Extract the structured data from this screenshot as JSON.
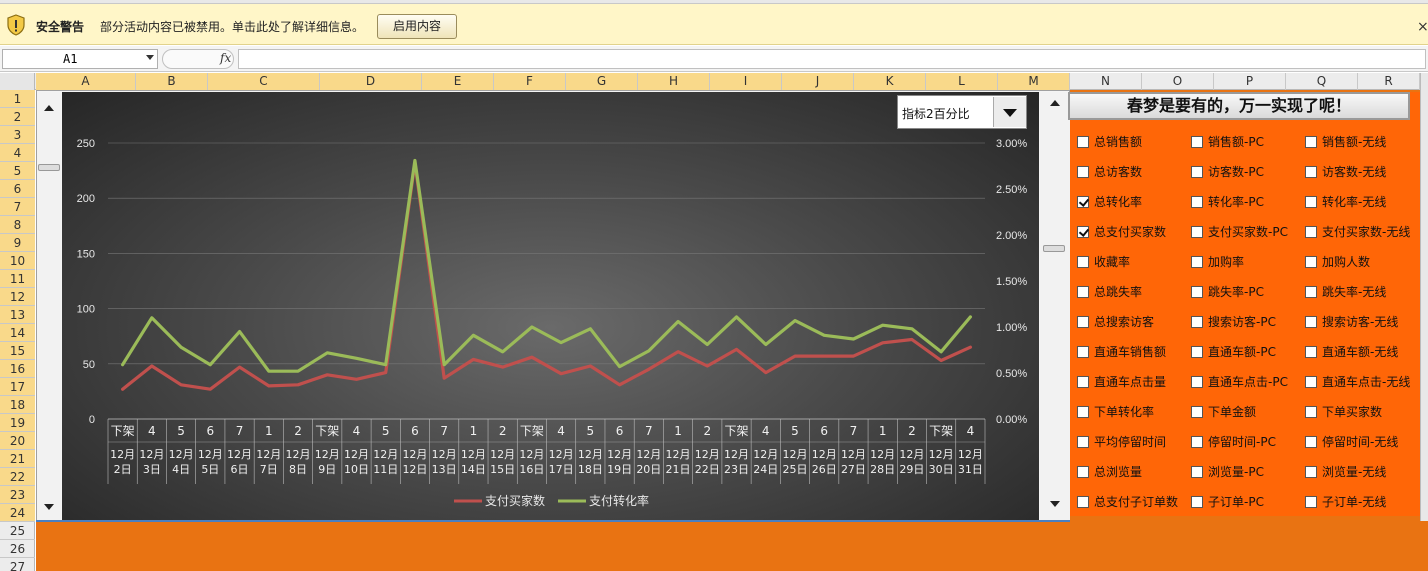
{
  "security_bar": {
    "title": "安全警告",
    "message": "部分活动内容已被禁用。单击此处了解详细信息。",
    "enable_button": "启用内容",
    "close": "×"
  },
  "formula_bar": {
    "name_box": "A1",
    "fx": "fx",
    "formula": ""
  },
  "columns": [
    "A",
    "B",
    "C",
    "D",
    "E",
    "F",
    "G",
    "H",
    "I",
    "J",
    "K",
    "L",
    "M",
    "N",
    "O",
    "P",
    "Q",
    "R"
  ],
  "rows": [
    "1",
    "2",
    "3",
    "4",
    "5",
    "6",
    "7",
    "8",
    "9",
    "10",
    "11",
    "12",
    "13",
    "14",
    "15",
    "16",
    "17",
    "18",
    "19",
    "20",
    "21",
    "22",
    "23",
    "24",
    "25",
    "26",
    "27"
  ],
  "dropdown": {
    "selected": "指标2百分比"
  },
  "panel": {
    "title": "春梦是要有的，万一实现了呢！",
    "checkboxes": [
      [
        {
          "label": "总销售额",
          "checked": false
        },
        {
          "label": "销售额-PC",
          "checked": false
        },
        {
          "label": "销售额-无线",
          "checked": false
        }
      ],
      [
        {
          "label": "总访客数",
          "checked": false
        },
        {
          "label": "访客数-PC",
          "checked": false
        },
        {
          "label": "访客数-无线",
          "checked": false
        }
      ],
      [
        {
          "label": "总转化率",
          "checked": true
        },
        {
          "label": "转化率-PC",
          "checked": false
        },
        {
          "label": "转化率-无线",
          "checked": false
        }
      ],
      [
        {
          "label": "总支付买家数",
          "checked": true
        },
        {
          "label": "支付买家数-PC",
          "checked": false
        },
        {
          "label": "支付买家数-无线",
          "checked": false
        }
      ],
      [
        {
          "label": "收藏率",
          "checked": false
        },
        {
          "label": "加购率",
          "checked": false
        },
        {
          "label": "加购人数",
          "checked": false
        }
      ],
      [
        {
          "label": "总跳失率",
          "checked": false
        },
        {
          "label": "跳失率-PC",
          "checked": false
        },
        {
          "label": "跳失率-无线",
          "checked": false
        }
      ],
      [
        {
          "label": "总搜索访客",
          "checked": false
        },
        {
          "label": "搜索访客-PC",
          "checked": false
        },
        {
          "label": "搜索访客-无线",
          "checked": false
        }
      ],
      [
        {
          "label": "直通车销售额",
          "checked": false
        },
        {
          "label": "直通车额-PC",
          "checked": false
        },
        {
          "label": "直通车额-无线",
          "checked": false
        }
      ],
      [
        {
          "label": "直通车点击量",
          "checked": false
        },
        {
          "label": "直通车点击-PC",
          "checked": false
        },
        {
          "label": "直通车点击-无线",
          "checked": false
        }
      ],
      [
        {
          "label": "下单转化率",
          "checked": false
        },
        {
          "label": "下单金额",
          "checked": false
        },
        {
          "label": "下单买家数",
          "checked": false
        }
      ],
      [
        {
          "label": "平均停留时间",
          "checked": false
        },
        {
          "label": "停留时间-PC",
          "checked": false
        },
        {
          "label": "停留时间-无线",
          "checked": false
        }
      ],
      [
        {
          "label": "总浏览量",
          "checked": false
        },
        {
          "label": "浏览量-PC",
          "checked": false
        },
        {
          "label": "浏览量-无线",
          "checked": false
        }
      ],
      [
        {
          "label": "总支付子订单数",
          "checked": false
        },
        {
          "label": "子订单-PC",
          "checked": false
        },
        {
          "label": "子订单-无线",
          "checked": false
        }
      ]
    ]
  },
  "chart_data": {
    "type": "line",
    "weekday_labels": [
      "下架",
      "4",
      "5",
      "6",
      "7",
      "1",
      "2",
      "下架",
      "4",
      "5",
      "6",
      "7",
      "1",
      "2",
      "下架",
      "4",
      "5",
      "6",
      "7",
      "1",
      "2",
      "下架",
      "4",
      "5",
      "6",
      "7",
      "1",
      "2",
      "下架",
      "4"
    ],
    "categories": [
      "12月2日",
      "12月3日",
      "12月4日",
      "12月5日",
      "12月6日",
      "12月7日",
      "12月8日",
      "12月9日",
      "12月10日",
      "12月11日",
      "12月12日",
      "12月13日",
      "12月14日",
      "12月15日",
      "12月16日",
      "12月17日",
      "12月18日",
      "12月19日",
      "12月20日",
      "12月21日",
      "12月22日",
      "12月23日",
      "12月24日",
      "12月25日",
      "12月26日",
      "12月27日",
      "12月28日",
      "12月29日",
      "12月30日",
      "12月31日"
    ],
    "y_left": {
      "ticks": [
        "0",
        "50",
        "100",
        "150",
        "200",
        "250"
      ],
      "ylim": [
        0,
        250
      ]
    },
    "y_right": {
      "ticks": [
        "0.00%",
        "0.50%",
        "1.00%",
        "1.50%",
        "2.00%",
        "2.50%",
        "3.00%"
      ],
      "ylim": [
        0,
        0.03
      ]
    },
    "series": [
      {
        "name": "支付买家数",
        "axis": "left",
        "color": "#c0504d",
        "values": [
          27,
          48,
          31,
          27,
          47,
          30,
          31,
          40,
          36,
          42,
          232,
          37,
          54,
          47,
          56,
          41,
          48,
          31,
          45,
          61,
          48,
          63,
          42,
          57,
          57,
          57,
          69,
          72,
          53,
          65
        ]
      },
      {
        "name": "支付转化率",
        "axis": "right",
        "color": "#9bbb59",
        "values": [
          0.0059,
          0.011,
          0.0078,
          0.0059,
          0.0095,
          0.0052,
          0.0052,
          0.0072,
          0.0066,
          0.0059,
          0.0281,
          0.0059,
          0.0091,
          0.0073,
          0.01,
          0.0083,
          0.0098,
          0.0057,
          0.0074,
          0.0106,
          0.0081,
          0.0111,
          0.0081,
          0.0107,
          0.0091,
          0.0087,
          0.0102,
          0.0098,
          0.0073,
          0.0111
        ]
      }
    ],
    "legend": "bottom"
  }
}
